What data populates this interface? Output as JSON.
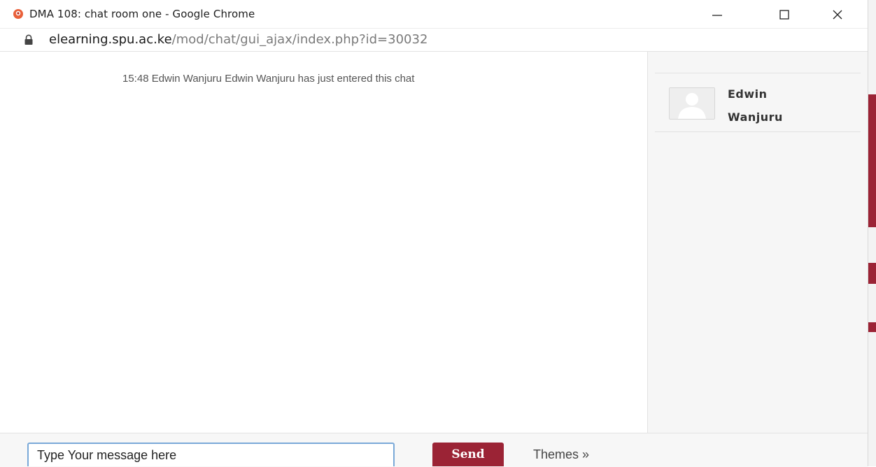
{
  "window": {
    "title": "DMA 108: chat room one - Google Chrome",
    "url_host": "elearning.spu.ac.ke",
    "url_path": "/mod/chat/gui_ajax/index.php?id=30032"
  },
  "chat": {
    "messages": [
      {
        "text": "15:48 Edwin Wanjuru Edwin Wanjuru has just entered this chat"
      }
    ]
  },
  "users": [
    {
      "name": "Edwin Wanjuru"
    }
  ],
  "input": {
    "value": "Type Your message here"
  },
  "buttons": {
    "send_label": "Send",
    "themes_label": "Themes »"
  },
  "colors": {
    "accent": "#9b2335",
    "input_focus": "#7aa9d8"
  }
}
